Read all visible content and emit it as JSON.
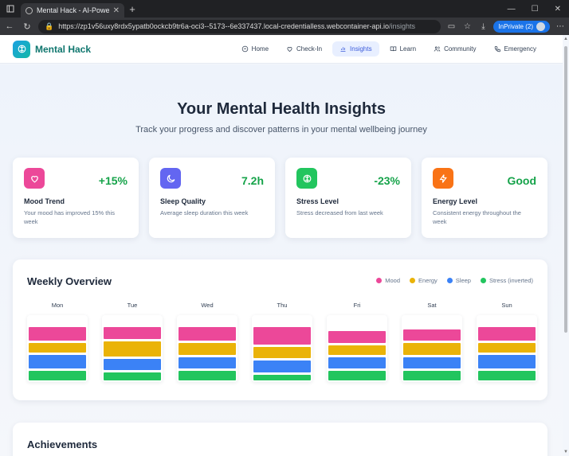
{
  "browser": {
    "tab_title": "Mental Hack - AI-Powered Mental",
    "url_main": "https://zp1v56uxy8rdx5ypatb0ockcb9tr6a-oci3--5173--6e337437.local-credentialless.webcontainer-api.io",
    "url_path": "/insights",
    "inprivate_label": "InPrivate (2)"
  },
  "app": {
    "name": "Mental Hack",
    "nav": [
      {
        "label": "Home",
        "icon": "home-icon"
      },
      {
        "label": "Check-In",
        "icon": "heart-icon"
      },
      {
        "label": "Insights",
        "icon": "bar-chart-icon",
        "active": true
      },
      {
        "label": "Learn",
        "icon": "book-icon"
      },
      {
        "label": "Community",
        "icon": "users-icon"
      },
      {
        "label": "Emergency",
        "icon": "phone-icon"
      }
    ]
  },
  "hero": {
    "title": "Your Mental Health Insights",
    "subtitle": "Track your progress and discover patterns in your mental wellbeing journey"
  },
  "stats": [
    {
      "value": "+15%",
      "label": "Mood Trend",
      "desc": "Your mood has improved 15% this week",
      "icon": "heart-icon",
      "color": "#ec4899"
    },
    {
      "value": "7.2h",
      "label": "Sleep Quality",
      "desc": "Average sleep duration this week",
      "icon": "moon-icon",
      "color": "#6366f1"
    },
    {
      "value": "-23%",
      "label": "Stress Level",
      "desc": "Stress decreased from last week",
      "icon": "brain-icon",
      "color": "#22c55e"
    },
    {
      "value": "Good",
      "label": "Energy Level",
      "desc": "Consistent energy throughout the week",
      "icon": "zap-icon",
      "color": "#f97316"
    }
  ],
  "weekly": {
    "title": "Weekly Overview",
    "legend": [
      {
        "name": "Mood",
        "color": "#ec4899"
      },
      {
        "name": "Energy",
        "color": "#eab308"
      },
      {
        "name": "Sleep",
        "color": "#3b82f6"
      },
      {
        "name": "Stress (inverted)",
        "color": "#22c55e"
      }
    ]
  },
  "chart_data": {
    "type": "bar",
    "title": "Weekly Overview",
    "categories": [
      "Mon",
      "Tue",
      "Wed",
      "Thu",
      "Fri",
      "Sat",
      "Sun"
    ],
    "series": [
      {
        "name": "Mood",
        "values": [
          7,
          6,
          7,
          9,
          6,
          6,
          7
        ]
      },
      {
        "name": "Energy",
        "values": [
          5,
          8,
          6,
          6,
          5,
          6,
          5
        ]
      },
      {
        "name": "Sleep",
        "values": [
          7,
          6,
          6,
          6,
          6,
          6,
          7
        ]
      },
      {
        "name": "Stress (inverted)",
        "values": [
          5,
          4,
          5,
          3,
          5,
          5,
          5
        ]
      }
    ]
  },
  "achievements": {
    "title": "Achievements"
  }
}
